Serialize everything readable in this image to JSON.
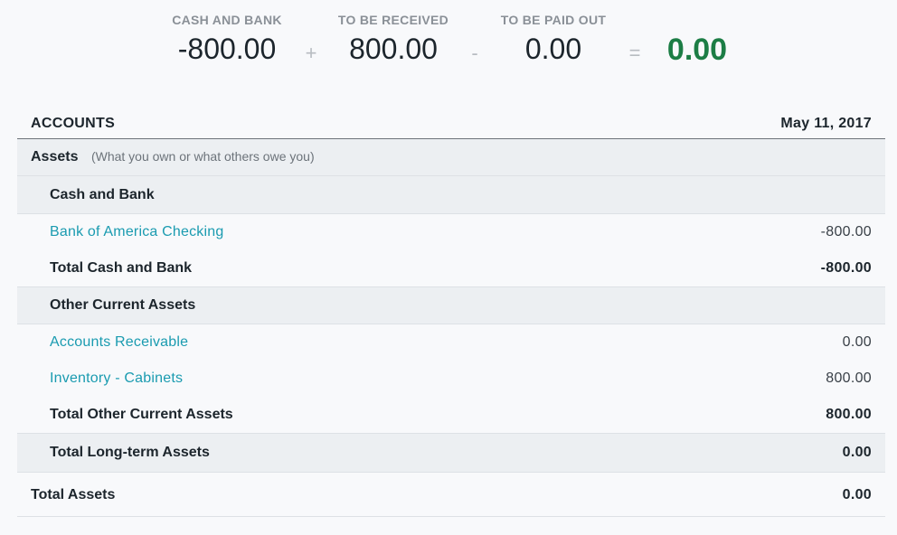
{
  "summary": {
    "cash_bank": {
      "label": "CASH AND BANK",
      "value": "-800.00"
    },
    "to_receive": {
      "label": "TO BE RECEIVED",
      "value": "800.00"
    },
    "to_pay": {
      "label": "TO BE PAID OUT",
      "value": "0.00"
    },
    "ops": {
      "plus": "+",
      "minus": "-",
      "equals": "="
    },
    "result": "0.00",
    "result_color": "#1c7d45"
  },
  "table": {
    "header_label": "ACCOUNTS",
    "date": "May 11, 2017",
    "assets": {
      "label": "Assets",
      "note": "(What you own or what others owe you)"
    },
    "cash_and_bank": {
      "label": "Cash and Bank",
      "items": [
        {
          "name": "Bank of America Checking",
          "amount": "-800.00"
        }
      ],
      "total_label": "Total Cash and Bank",
      "total": "-800.00"
    },
    "other_current": {
      "label": "Other Current Assets",
      "items": [
        {
          "name": "Accounts Receivable",
          "amount": "0.00"
        },
        {
          "name": "Inventory - Cabinets",
          "amount": "800.00"
        }
      ],
      "total_label": "Total Other Current Assets",
      "total": "800.00"
    },
    "long_term": {
      "total_label": "Total Long-term Assets",
      "total": "0.00"
    },
    "total_assets": {
      "label": "Total Assets",
      "value": "0.00"
    }
  }
}
